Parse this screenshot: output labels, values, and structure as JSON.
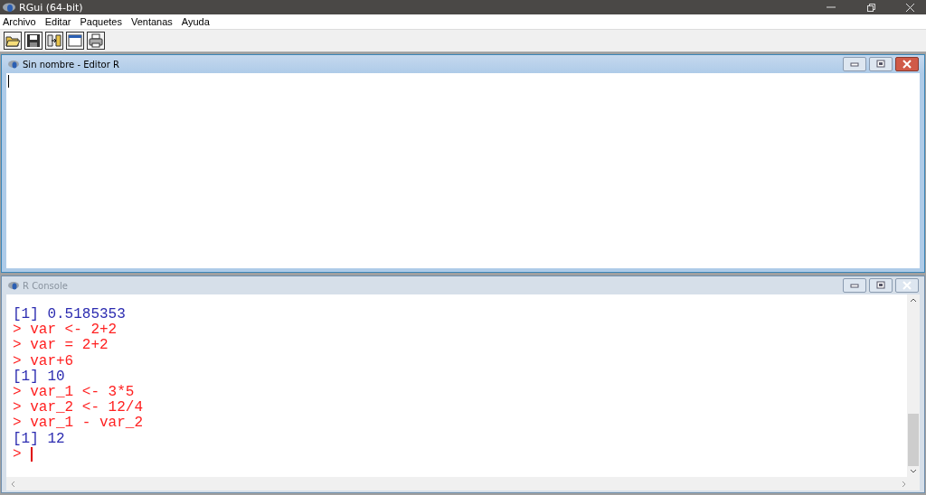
{
  "window": {
    "title": "RGui (64-bit)"
  },
  "menu": [
    "Archivo",
    "Editar",
    "Paquetes",
    "Ventanas",
    "Ayuda"
  ],
  "toolbar": [
    {
      "kind": "open"
    },
    {
      "kind": "save"
    },
    {
      "kind": "paste"
    },
    {
      "kind": "window"
    },
    {
      "kind": "print"
    }
  ],
  "windows": [
    {
      "kind": "editor",
      "title": "Sin nombre - Editor R",
      "active": true
    },
    {
      "kind": "console",
      "title": "R Console",
      "active": false,
      "lines": [
        {
          "kind": "output",
          "text": "[1] 0.5185353"
        },
        {
          "kind": "input",
          "text": "> var <- 2+2"
        },
        {
          "kind": "input",
          "text": "> var = 2+2"
        },
        {
          "kind": "input",
          "text": "> var+6"
        },
        {
          "kind": "output",
          "text": "[1] 10"
        },
        {
          "kind": "input",
          "text": "> var_1 <- 3*5"
        },
        {
          "kind": "input",
          "text": "> var_2 <- 12/4"
        },
        {
          "kind": "input",
          "text": "> var_1 - var_2"
        },
        {
          "kind": "output",
          "text": "[1] 12"
        },
        {
          "kind": "prompt",
          "text": ">"
        }
      ]
    }
  ]
}
